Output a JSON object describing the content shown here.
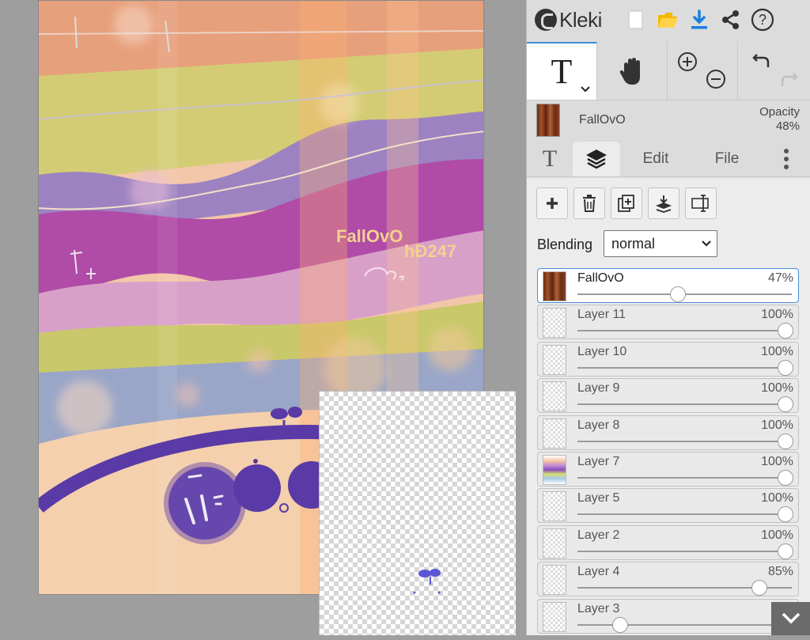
{
  "app": {
    "name": "Kleki"
  },
  "canvas": {
    "artwork_text_1": "FallOvO",
    "artwork_text_2": "hÐ247"
  },
  "toolbar": {
    "icons": [
      "new-file-icon",
      "open-folder-icon",
      "download-icon",
      "share-icon",
      "help-icon"
    ],
    "tools": [
      "text-tool",
      "hand-tool",
      "zoom-in-icon",
      "zoom-out-icon",
      "undo-icon",
      "redo-icon"
    ],
    "text_tool_label": "T"
  },
  "current_layer": {
    "name": "FallOvO",
    "opacity_label": "Opacity",
    "opacity_value": "48%"
  },
  "tabs": {
    "text": "T",
    "edit": "Edit",
    "file": "File"
  },
  "layers_panel": {
    "actions": [
      "add-layer-icon",
      "delete-layer-icon",
      "duplicate-layer-icon",
      "merge-down-icon",
      "rename-layer-icon"
    ],
    "blending_label": "Blending",
    "blending_value": "normal",
    "layers": [
      {
        "name": "FallOvO",
        "opacity": "47%",
        "fraction": 0.47,
        "selected": true,
        "thumb": "wood"
      },
      {
        "name": "Layer 11",
        "opacity": "100%",
        "fraction": 1.0
      },
      {
        "name": "Layer 10",
        "opacity": "100%",
        "fraction": 1.0
      },
      {
        "name": "Layer 9",
        "opacity": "100%",
        "fraction": 1.0
      },
      {
        "name": "Layer 8",
        "opacity": "100%",
        "fraction": 1.0
      },
      {
        "name": "Layer 7",
        "opacity": "100%",
        "fraction": 1.0,
        "thumb": "rainbow"
      },
      {
        "name": "Layer 5",
        "opacity": "100%",
        "fraction": 1.0
      },
      {
        "name": "Layer 2",
        "opacity": "100%",
        "fraction": 1.0
      },
      {
        "name": "Layer 4",
        "opacity": "85%",
        "fraction": 0.85
      },
      {
        "name": "Layer 3",
        "opacity": "2",
        "fraction": 0.2
      }
    ]
  },
  "colors": {
    "accent": "#3b8fd9",
    "download": "#1a7fe0",
    "folder": "#f5b800",
    "purple": "#5a3aa6"
  }
}
